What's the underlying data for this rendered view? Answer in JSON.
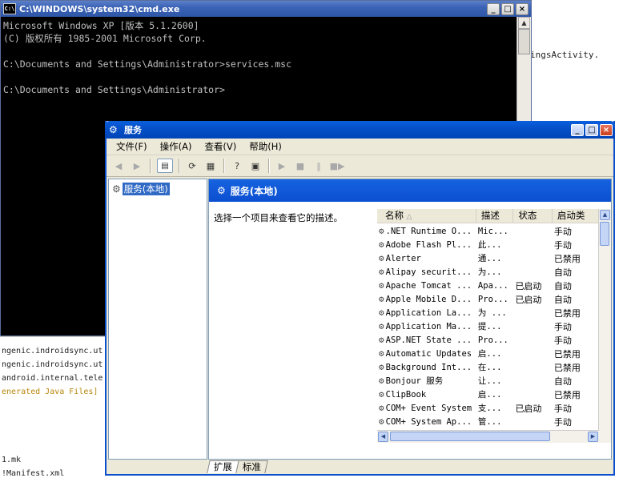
{
  "background": {
    "right_text": "ingsActivity.",
    "bottom_lines": [
      "ngenic.indroidsync.ut",
      "ngenic.indroidsync.ut",
      " android.internal.tele",
      "enerated Java Files]",
      "1.mk",
      "!Manifest.xml"
    ]
  },
  "cmd": {
    "title": "C:\\WINDOWS\\system32\\cmd.exe",
    "icon_label": "C:\\",
    "lines": [
      "Microsoft Windows XP [版本 5.1.2600]",
      "(C) 版权所有 1985-2001 Microsoft Corp.",
      "",
      "C:\\Documents and Settings\\Administrator>services.msc",
      "",
      "C:\\Documents and Settings\\Administrator>"
    ]
  },
  "services": {
    "title": "服务",
    "menu": [
      "文件(F)",
      "操作(A)",
      "查看(V)",
      "帮助(H)"
    ],
    "tree_item": "服务(本地)",
    "pane_header": "服务(本地)",
    "description": "选择一个项目来查看它的描述。",
    "columns": [
      "名称",
      "描述",
      "状态",
      "启动类"
    ],
    "rows": [
      {
        "name": ".NET Runtime O...",
        "desc": "Mic...",
        "status": "",
        "startup": "手动"
      },
      {
        "name": "Adobe Flash Pl...",
        "desc": "此...",
        "status": "",
        "startup": "手动"
      },
      {
        "name": "Alerter",
        "desc": "通...",
        "status": "",
        "startup": "已禁用"
      },
      {
        "name": "Alipay securit...",
        "desc": "为...",
        "status": "",
        "startup": "自动"
      },
      {
        "name": "Apache Tomcat ...",
        "desc": "Apa...",
        "status": "已启动",
        "startup": "自动"
      },
      {
        "name": "Apple Mobile D...",
        "desc": "Pro...",
        "status": "已启动",
        "startup": "自动"
      },
      {
        "name": "Application La...",
        "desc": "为 ...",
        "status": "",
        "startup": "已禁用"
      },
      {
        "name": "Application Ma...",
        "desc": "提...",
        "status": "",
        "startup": "手动"
      },
      {
        "name": "ASP.NET State ...",
        "desc": "Pro...",
        "status": "",
        "startup": "手动"
      },
      {
        "name": "Automatic Updates",
        "desc": "启...",
        "status": "",
        "startup": "已禁用"
      },
      {
        "name": "Background Int...",
        "desc": "在...",
        "status": "",
        "startup": "已禁用"
      },
      {
        "name": "Bonjour 服务",
        "desc": "让...",
        "status": "",
        "startup": "自动"
      },
      {
        "name": "ClipBook",
        "desc": "启...",
        "status": "",
        "startup": "已禁用"
      },
      {
        "name": "COM+ Event System",
        "desc": "支...",
        "status": "已启动",
        "startup": "手动"
      },
      {
        "name": "COM+ System Ap...",
        "desc": "管...",
        "status": "",
        "startup": "手动"
      }
    ],
    "tabs": [
      "扩展",
      "标准"
    ]
  }
}
